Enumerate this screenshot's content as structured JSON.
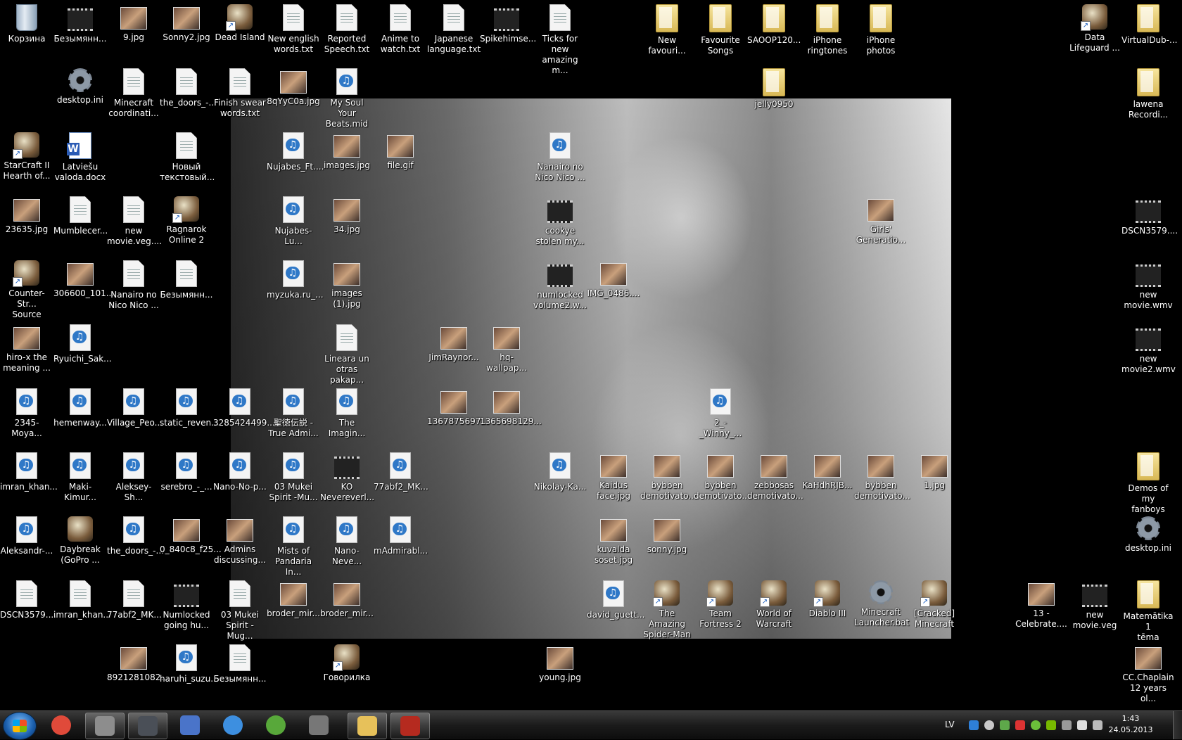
{
  "desktop": {
    "icons": [
      {
        "label": "Корзина",
        "icon": "recycle-bin-icon"
      },
      {
        "label": "Безымянн...",
        "icon": "video-file-icon"
      },
      {
        "label": "9.jpg",
        "icon": "image-file-icon"
      },
      {
        "label": "Sonny2.jpg",
        "icon": "image-file-icon"
      },
      {
        "label": "Dead Island",
        "icon": "game-shortcut-icon"
      },
      {
        "label": "New english\nwords.txt",
        "icon": "text-file-icon"
      },
      {
        "label": "Reported\nSpeech.txt",
        "icon": "text-file-icon"
      },
      {
        "label": "Anime to\nwatch.txt",
        "icon": "text-file-icon"
      },
      {
        "label": "Japanese\nlanguage.txt",
        "icon": "text-file-icon"
      },
      {
        "label": "Spikehimse...",
        "icon": "video-file-icon"
      },
      {
        "label": "Ticks for new\namazing m...",
        "icon": "text-file-icon"
      },
      {
        "label": "New\nfavouri...",
        "icon": "folder-icon"
      },
      {
        "label": "Favourite\nSongs",
        "icon": "folder-icon"
      },
      {
        "label": "SAOOP120...",
        "icon": "folder-icon"
      },
      {
        "label": "iPhone\nringtones",
        "icon": "folder-icon"
      },
      {
        "label": "iPhone\nphotos",
        "icon": "folder-icon"
      },
      {
        "label": "Data\nLifeguard ...",
        "icon": "app-shortcut-icon"
      },
      {
        "label": "VirtualDub-...",
        "icon": "folder-icon"
      },
      {
        "label": "desktop.ini",
        "icon": "settings-file-icon"
      },
      {
        "label": "Minecraft\ncoordinati...",
        "icon": "text-file-icon"
      },
      {
        "label": "the_doors_-...",
        "icon": "text-file-icon"
      },
      {
        "label": "Finish swear\nwords.txt",
        "icon": "text-file-icon"
      },
      {
        "label": "8qYyC0a.jpg",
        "icon": "image-file-icon"
      },
      {
        "label": "My Soul Your\nBeats.mid",
        "icon": "audio-file-icon"
      },
      {
        "label": "jelly0950",
        "icon": "folder-icon"
      },
      {
        "label": "lawena\nRecordi...",
        "icon": "folder-icon"
      },
      {
        "label": "StarCraft II\nHearth of...",
        "icon": "game-shortcut-icon"
      },
      {
        "label": "Latviešu\nvaloda.docx",
        "icon": "word-document-icon"
      },
      {
        "label": "Новый\nтекстовый...",
        "icon": "text-file-icon"
      },
      {
        "label": "Nujabes_Ft....",
        "icon": "audio-file-icon"
      },
      {
        "label": "images.jpg",
        "icon": "image-file-icon"
      },
      {
        "label": "file.gif",
        "icon": "image-file-icon"
      },
      {
        "label": "Nanairo no\nNico Nico ...",
        "icon": "audio-file-icon"
      },
      {
        "label": "23635.jpg",
        "icon": "image-file-icon"
      },
      {
        "label": "Mumblecer...",
        "icon": "certificate-file-icon"
      },
      {
        "label": "new\nmovie.veg....",
        "icon": "text-file-icon"
      },
      {
        "label": "Ragnarok\nOnline 2",
        "icon": "game-shortcut-icon"
      },
      {
        "label": "Nujabes-Lu...",
        "icon": "audio-file-icon"
      },
      {
        "label": "34.jpg",
        "icon": "image-file-icon"
      },
      {
        "label": "cookye\nstolen my...",
        "icon": "video-file-icon"
      },
      {
        "label": "Girls'\nGeneratio...",
        "icon": "image-file-icon"
      },
      {
        "label": "DSCN3579....",
        "icon": "video-file-icon"
      },
      {
        "label": "Counter-Str...\nSource",
        "icon": "game-shortcut-icon"
      },
      {
        "label": "306600_101...",
        "icon": "image-file-icon"
      },
      {
        "label": "Nanairo no\nNico Nico ...",
        "icon": "text-file-icon"
      },
      {
        "label": "Безымянн...",
        "icon": "text-file-icon"
      },
      {
        "label": "myzuka.ru_...",
        "icon": "audio-file-icon"
      },
      {
        "label": "images\n(1).jpg",
        "icon": "image-file-icon"
      },
      {
        "label": "numlocked\nvolume2.w...",
        "icon": "video-file-icon"
      },
      {
        "label": "IMG_0486....",
        "icon": "image-file-icon"
      },
      {
        "label": "new\nmovie.wmv",
        "icon": "video-file-icon"
      },
      {
        "label": "hiro-x the\nmeaning ...",
        "icon": "image-file-icon"
      },
      {
        "label": "Ryuichi_Sak...",
        "icon": "audio-file-icon"
      },
      {
        "label": "Lineara un\notras pakap...",
        "icon": "text-file-icon"
      },
      {
        "label": "JimRaynor...",
        "icon": "image-file-icon"
      },
      {
        "label": "hq-wallpap...",
        "icon": "image-file-icon"
      },
      {
        "label": "new\nmovie2.wmv",
        "icon": "video-file-icon"
      },
      {
        "label": "2345-Moya...",
        "icon": "audio-file-icon"
      },
      {
        "label": "hemenway...",
        "icon": "audio-file-icon"
      },
      {
        "label": "Village_Peo...",
        "icon": "audio-file-icon"
      },
      {
        "label": "static_reven...",
        "icon": "audio-file-icon"
      },
      {
        "label": "3285424499...",
        "icon": "audio-file-icon"
      },
      {
        "label": "聖徳伝説 -\nTrue Admi...",
        "icon": "audio-file-icon"
      },
      {
        "label": "The Imagin...",
        "icon": "audio-file-icon"
      },
      {
        "label": "1367875697...",
        "icon": "image-file-icon"
      },
      {
        "label": "1365698129...",
        "icon": "image-file-icon"
      },
      {
        "label": "2_-_Winny_...",
        "icon": "audio-file-icon"
      },
      {
        "label": "imran_khan...",
        "icon": "audio-file-icon"
      },
      {
        "label": "Maki-Kimur...",
        "icon": "audio-file-icon"
      },
      {
        "label": "Aleksey-Sh...",
        "icon": "audio-file-icon"
      },
      {
        "label": "serebro_-_...",
        "icon": "audio-file-icon"
      },
      {
        "label": "Nano-No-p...",
        "icon": "audio-file-icon"
      },
      {
        "label": "03 Mukei\nSpirit -Mu...",
        "icon": "audio-file-icon"
      },
      {
        "label": "KO\nNevereverl...",
        "icon": "video-file-icon"
      },
      {
        "label": "77abf2_MK...",
        "icon": "audio-file-icon"
      },
      {
        "label": "Nikolay-Ka...",
        "icon": "audio-file-icon"
      },
      {
        "label": "Kaidus\nface.jpg",
        "icon": "image-file-icon"
      },
      {
        "label": "bybben\ndemotivato...",
        "icon": "image-file-icon"
      },
      {
        "label": "bybben\ndemotivato...",
        "icon": "image-file-icon"
      },
      {
        "label": "zebbosas\ndemotivato...",
        "icon": "image-file-icon"
      },
      {
        "label": "KaHdhRJB...",
        "icon": "image-file-icon"
      },
      {
        "label": "bybben\ndemotivato...",
        "icon": "image-file-icon"
      },
      {
        "label": "1.jpg",
        "icon": "image-file-icon"
      },
      {
        "label": "Demos of my\nfanboys",
        "icon": "folder-icon"
      },
      {
        "label": "Aleksandr-...",
        "icon": "audio-file-icon"
      },
      {
        "label": "Daybreak\n(GoPro ...",
        "icon": "app-icon"
      },
      {
        "label": "the_doors_-...",
        "icon": "audio-file-icon"
      },
      {
        "label": "0_840c8_f25...",
        "icon": "image-file-icon"
      },
      {
        "label": "Admins\ndiscussing...",
        "icon": "image-file-icon"
      },
      {
        "label": "Mists of\nPandaria In...",
        "icon": "audio-file-icon"
      },
      {
        "label": "Nano-Neve...",
        "icon": "audio-file-icon"
      },
      {
        "label": "mAdmirabl...",
        "icon": "audio-file-icon"
      },
      {
        "label": "kuvalda\nsoset.jpg",
        "icon": "image-file-icon"
      },
      {
        "label": "sonny.jpg",
        "icon": "image-file-icon"
      },
      {
        "label": "desktop.ini",
        "icon": "settings-file-icon"
      },
      {
        "label": "DSCN3579....",
        "icon": "text-file-icon"
      },
      {
        "label": "imran_khan...",
        "icon": "text-file-icon"
      },
      {
        "label": "77abf2_MK...",
        "icon": "text-file-icon"
      },
      {
        "label": "Numlocked\ngoing hu...",
        "icon": "video-file-icon"
      },
      {
        "label": "03 Mukei\nSpirit -Mug...",
        "icon": "text-file-icon"
      },
      {
        "label": "broder_mir...",
        "icon": "image-file-icon"
      },
      {
        "label": "broder_mir...",
        "icon": "image-file-icon"
      },
      {
        "label": "david_guett...",
        "icon": "audio-file-icon"
      },
      {
        "label": "The Amazing\nSpider-Man",
        "icon": "game-shortcut-icon"
      },
      {
        "label": "Team\nFortress 2",
        "icon": "game-shortcut-icon"
      },
      {
        "label": "World of\nWarcraft",
        "icon": "game-shortcut-icon"
      },
      {
        "label": "Diablo III",
        "icon": "game-shortcut-icon"
      },
      {
        "label": "Minecraft\nLauncher.bat",
        "icon": "batch-file-icon"
      },
      {
        "label": "[Cracked]\nMinecraft",
        "icon": "game-shortcut-icon"
      },
      {
        "label": "13 -\nCelebrate....",
        "icon": "image-file-icon"
      },
      {
        "label": "new\nmovie.veg",
        "icon": "video-file-icon"
      },
      {
        "label": "Matemātika 1\ntēma",
        "icon": "folder-icon"
      },
      {
        "label": "8921281082...",
        "icon": "image-file-icon"
      },
      {
        "label": "haruhi_suzu...",
        "icon": "audio-file-icon"
      },
      {
        "label": "Безымянн...",
        "icon": "text-file-icon"
      },
      {
        "label": "Говорилка",
        "icon": "app-shortcut-icon"
      },
      {
        "label": "young.jpg",
        "icon": "image-file-icon"
      },
      {
        "label": "CC.Chaplain\n12 years ol...",
        "icon": "image-file-icon"
      }
    ]
  },
  "taskbar": {
    "start_icon": "windows-start-icon",
    "pinned": [
      {
        "name": "chrome-icon",
        "active": false
      },
      {
        "name": "bandicam-icon",
        "active": true
      },
      {
        "name": "steam-icon",
        "active": true
      },
      {
        "name": "mozilla-app-icon",
        "active": false
      },
      {
        "name": "itunes-icon",
        "active": false
      },
      {
        "name": "utorrent-icon",
        "active": false
      },
      {
        "name": "gimp-icon",
        "active": false
      },
      {
        "name": "file-explorer-icon",
        "active": true
      },
      {
        "name": "dota2-icon",
        "active": true
      }
    ],
    "tray": {
      "language": "LV",
      "time": "1:43",
      "date": "24.05.2013"
    }
  },
  "colors": {
    "desktop_background": "#000000",
    "taskbar": "#1b1b1b",
    "label_text": "#ffffff"
  }
}
